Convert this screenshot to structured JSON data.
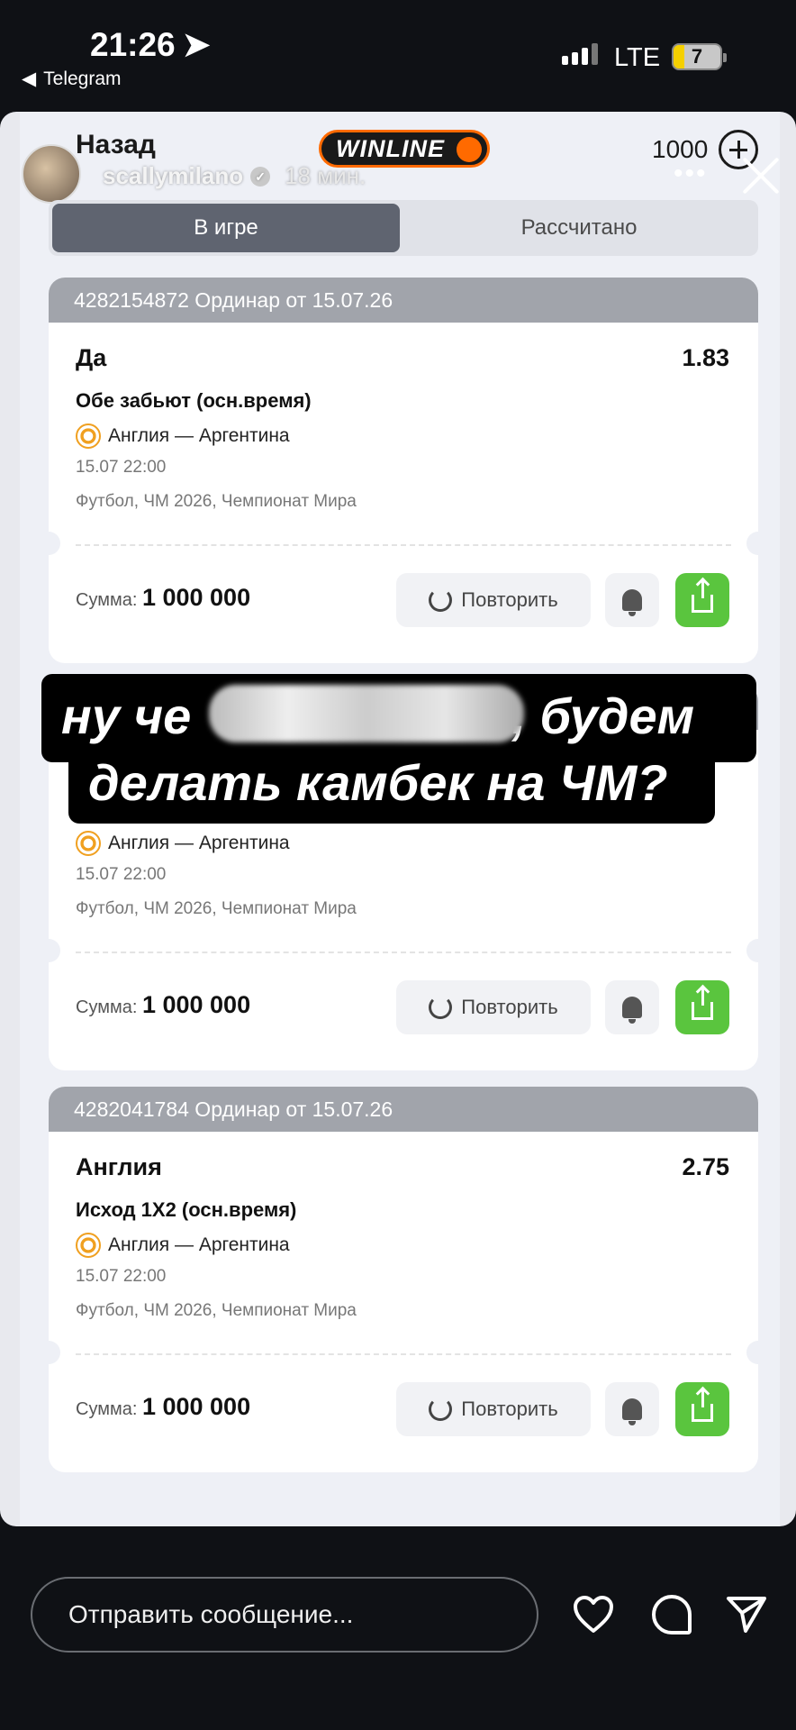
{
  "status": {
    "time": "21:26",
    "back_app": "Telegram",
    "network": "LTE",
    "battery": "7"
  },
  "header": {
    "back_label": "Назад",
    "brand": "WINLINE",
    "balance": "1000",
    "username": "scallymilano",
    "time_ago": "18 мин."
  },
  "tabs": {
    "active": "В игре",
    "other": "Рассчитано"
  },
  "labels": {
    "sum": "Сумма:",
    "repeat": "Повторить"
  },
  "bets": [
    {
      "header": "4282154872  Ординар от 15.07.26",
      "pick": "Да",
      "odds": "1.83",
      "market": "Обе забьют (осн.время)",
      "match": "Англия — Аргентина",
      "date": "15.07 22:00",
      "league": "Футбол, ЧМ 2026, Чемпионат Мира",
      "sum": "1 000 000"
    },
    {
      "header": "",
      "pick": "",
      "odds": "",
      "market": "",
      "match": "Англия — Аргентина",
      "date": "15.07 22:00",
      "league": "Футбол, ЧМ 2026, Чемпионат Мира",
      "sum": "1 000 000"
    },
    {
      "header": "4282041784  Ординар от 15.07.26",
      "pick": "Англия",
      "odds": "2.75",
      "market": "Исход 1Х2 (осн.время)",
      "match": "Англия — Аргентина",
      "date": "15.07 22:00",
      "league": "Футбол, ЧМ 2026, Чемпионат Мира",
      "sum": "1 000 000"
    }
  ],
  "caption": {
    "line1_start": "ну че",
    "line1_end": ", будем",
    "line2": "делать камбек на ЧМ?"
  },
  "reply": {
    "placeholder": "Отправить сообщение..."
  },
  "colors": {
    "accent": "#ff6a00",
    "share": "#5ac53e",
    "tab_active": "#5f6470"
  }
}
